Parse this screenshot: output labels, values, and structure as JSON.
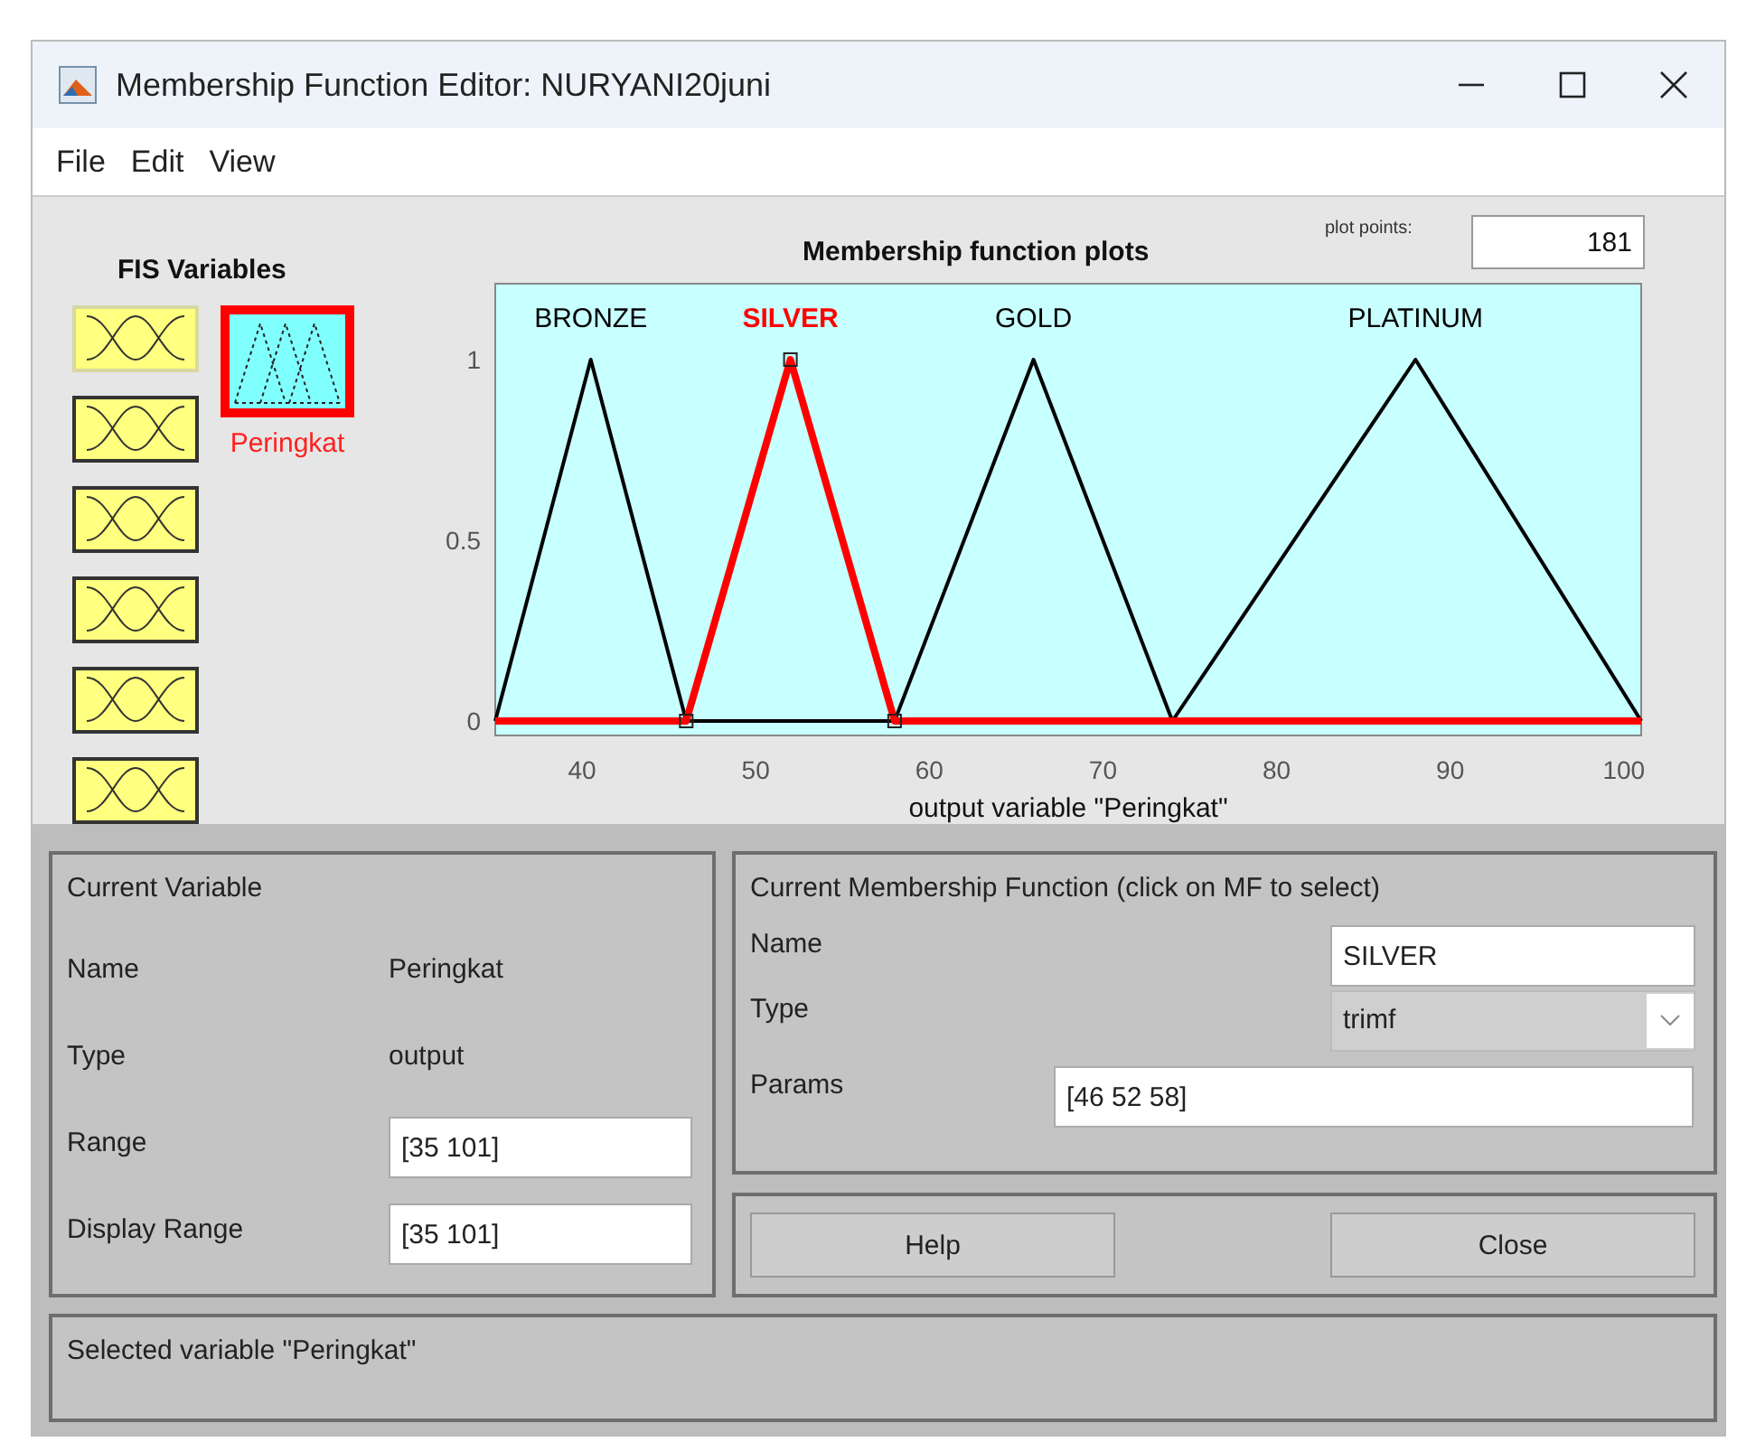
{
  "window": {
    "title": "Membership Function Editor: NURYANI20juni"
  },
  "menu": [
    "File",
    "Edit",
    "View"
  ],
  "fis_variables": {
    "title": "FIS Variables",
    "inputs": [
      {
        "selected": false
      },
      {
        "selected": false
      },
      {
        "selected": false
      },
      {
        "selected": false
      },
      {
        "selected": false
      },
      {
        "selected": false
      }
    ],
    "outputs": [
      {
        "name": "Peringkat",
        "selected": true
      }
    ]
  },
  "plot": {
    "plot_points_label": "plot points:",
    "plot_points": "181",
    "chart_data": {
      "type": "line",
      "title": "Membership function plots",
      "xlabel": "output variable \"Peringkat\"",
      "x": [
        35,
        40.5,
        46,
        52,
        58,
        66,
        74,
        88,
        101
      ],
      "series": [
        {
          "name": "BRONZE",
          "color": "#000000",
          "values": [
            0,
            1,
            0,
            0,
            0,
            0,
            0,
            0,
            0
          ]
        },
        {
          "name": "SILVER",
          "color": "#ff0000",
          "values": [
            0,
            0,
            0,
            1,
            0,
            0,
            0,
            0,
            0
          ]
        },
        {
          "name": "GOLD",
          "color": "#000000",
          "values": [
            0,
            0,
            0,
            0,
            0,
            1,
            0,
            0,
            0
          ]
        },
        {
          "name": "PLATINUM",
          "color": "#000000",
          "values": [
            0,
            0,
            0,
            0,
            0,
            0,
            0,
            1,
            0
          ]
        }
      ],
      "xlim": [
        35,
        101
      ],
      "ylim": [
        -0.04,
        1.21
      ],
      "xticks": [
        40,
        50,
        60,
        70,
        80,
        90,
        100
      ],
      "yticks": [
        0,
        0.5,
        1
      ]
    },
    "membership_functions": [
      {
        "selected": false
      },
      {
        "selected": true
      },
      {
        "selected": false
      },
      {
        "selected": false
      }
    ]
  },
  "current_variable": {
    "title": "Current Variable",
    "name_label": "Name",
    "name": "Peringkat",
    "type_label": "Type",
    "type": "output",
    "range_label": "Range",
    "range": "[35 101]",
    "display_range_label": "Display Range",
    "display_range": "[35 101]"
  },
  "current_mf": {
    "title": "Current Membership Function (click on MF to select)",
    "name_label": "Name",
    "name": "SILVER",
    "type_label": "Type",
    "type": "trimf",
    "params_label": "Params",
    "params": "[46 52 58]"
  },
  "buttons": [
    "Help",
    "Close"
  ],
  "status_bar": "Selected variable \"Peringkat\""
}
